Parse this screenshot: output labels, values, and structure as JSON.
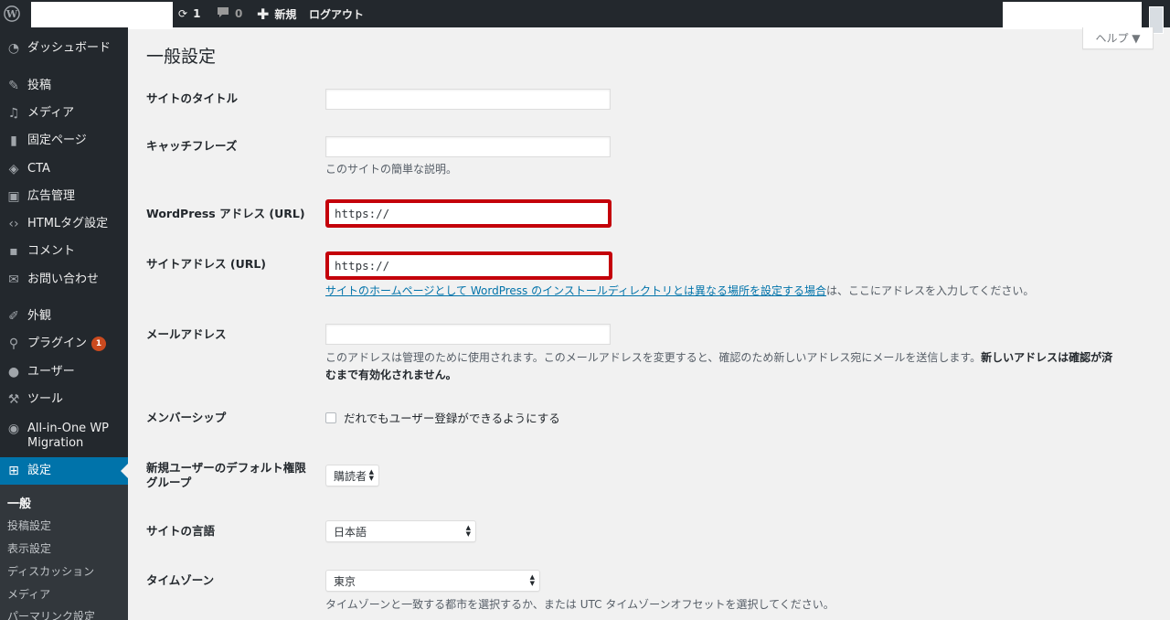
{
  "adminbar": {
    "wp_logo_icon": "wordpress-logo-icon",
    "updates_count": "1",
    "comments_count": "0",
    "new_label": "新規",
    "logout_label": "ログアウト"
  },
  "sidebar": {
    "items": [
      {
        "label": "ダッシュボード",
        "icon": "dashboard-icon"
      },
      {
        "label": "投稿",
        "icon": "pin-icon"
      },
      {
        "label": "メディア",
        "icon": "media-icon"
      },
      {
        "label": "固定ページ",
        "icon": "page-icon"
      },
      {
        "label": "CTA",
        "icon": "tag-icon"
      },
      {
        "label": "広告管理",
        "icon": "ad-icon"
      },
      {
        "label": "HTMLタグ設定",
        "icon": "code-icon"
      },
      {
        "label": "コメント",
        "icon": "comment-icon"
      },
      {
        "label": "お問い合わせ",
        "icon": "mail-icon"
      },
      {
        "label": "外観",
        "icon": "brush-icon"
      },
      {
        "label": "プラグイン",
        "icon": "plugin-icon",
        "badge": "1"
      },
      {
        "label": "ユーザー",
        "icon": "user-icon"
      },
      {
        "label": "ツール",
        "icon": "wrench-icon"
      },
      {
        "label": "All-in-One WP",
        "label2": "Migration",
        "icon": "migration-icon"
      },
      {
        "label": "設定",
        "icon": "settings-icon"
      }
    ],
    "submenu": [
      "一般",
      "投稿設定",
      "表示設定",
      "ディスカッション",
      "メディア",
      "パーマリンク設定"
    ]
  },
  "help_tab": "ヘルプ ▼",
  "page_title": "一般設定",
  "form": {
    "site_title": {
      "label": "サイトのタイトル",
      "value": ""
    },
    "tagline": {
      "label": "キャッチフレーズ",
      "value": "",
      "desc": "このサイトの簡単な説明。"
    },
    "wp_address": {
      "label": "WordPress アドレス (URL)",
      "value": "https://"
    },
    "site_address": {
      "label": "サイトアドレス (URL)",
      "value": "https://",
      "desc_link": "サイトのホームページとして WordPress のインストールディレクトリとは異なる場所を設定する場合",
      "desc_rest": "は、ここにアドレスを入力してください。"
    },
    "email": {
      "label": "メールアドレス",
      "value": "",
      "desc_1": "このアドレスは管理のために使用されます。このメールアドレスを変更すると、確認のため新しいアドレス宛にメールを送信します。",
      "desc_bold_1": "新しいアドレスは確認が済",
      "desc_bold_2": "むまで有効化されません。"
    },
    "membership": {
      "label": "メンバーシップ",
      "checkbox_label": "だれでもユーザー登録ができるようにする",
      "checked": false
    },
    "default_role": {
      "label_1": "新規ユーザーのデフォルト権限",
      "label_2": "グループ",
      "value": "購読者"
    },
    "language": {
      "label": "サイトの言語",
      "value": "日本語"
    },
    "timezone": {
      "label": "タイムゾーン",
      "value": "東京",
      "desc": "タイムゾーンと一致する都市を選択するか、または UTC タイムゾーンオフセットを選択してください。"
    }
  },
  "colors": {
    "accent": "#0073aa",
    "highlight_border": "#c4000a",
    "sidebar_bg": "#23282d"
  }
}
